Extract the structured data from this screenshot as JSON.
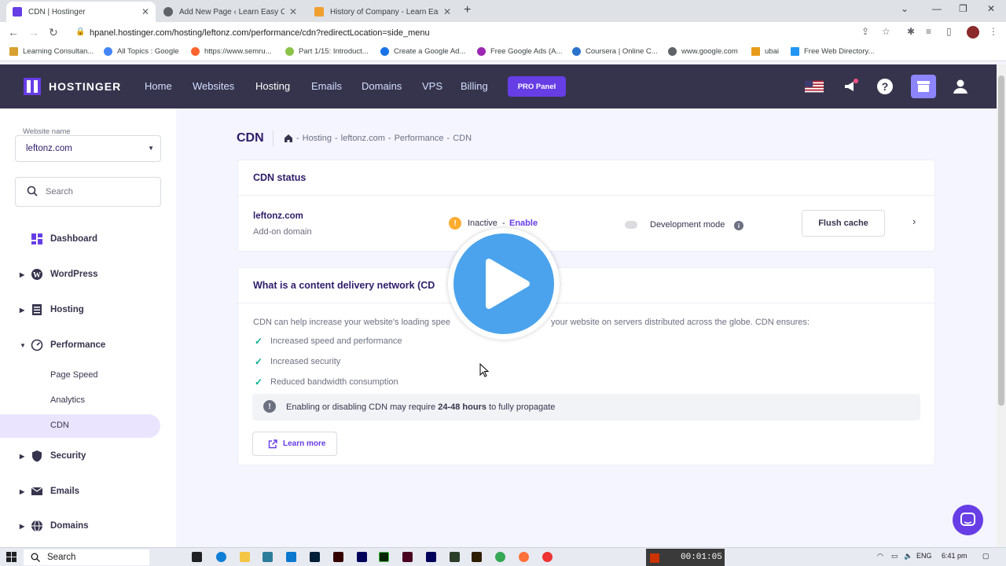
{
  "browser": {
    "tabs": [
      {
        "title": "CDN | Hostinger",
        "active": true
      },
      {
        "title": "Add New Page ‹ Learn Easy Codi",
        "active": false
      },
      {
        "title": "History of Company - Learn Easy",
        "active": false
      }
    ],
    "url": "hpanel.hostinger.com/hosting/leftonz.com/performance/cdn?redirectLocation=side_menu",
    "bookmarks": [
      "Learning Consultan...",
      "All Topics : Google",
      "https://www.semru...",
      "Part 1/15: Introduct...",
      "Create a Google Ad...",
      "Free Google Ads (A...",
      "Coursera | Online C...",
      "www.google.com",
      "ubai",
      "Free Web Directory..."
    ]
  },
  "header": {
    "brand": "HOSTINGER",
    "nav": [
      "Home",
      "Websites",
      "Hosting",
      "Emails",
      "Domains",
      "VPS",
      "Billing"
    ],
    "active_nav": "Hosting",
    "pro_panel": "PRO Panel"
  },
  "sidebar": {
    "website_label": "Website name",
    "website_value": "leftonz.com",
    "search_placeholder": "Search",
    "items": [
      {
        "label": "Dashboard",
        "icon": "dashboard-icon"
      },
      {
        "label": "WordPress",
        "icon": "wordpress-icon"
      },
      {
        "label": "Hosting",
        "icon": "server-icon"
      },
      {
        "label": "Performance",
        "icon": "gauge-icon"
      },
      {
        "label": "Security",
        "icon": "shield-icon"
      },
      {
        "label": "Emails",
        "icon": "mail-icon"
      },
      {
        "label": "Domains",
        "icon": "globe-icon"
      }
    ],
    "sub_items": [
      "Page Speed",
      "Analytics",
      "CDN"
    ]
  },
  "main": {
    "title": "CDN",
    "breadcrumb": [
      "Hosting",
      "leftonz.com",
      "Performance",
      "CDN"
    ],
    "status_card": {
      "title": "CDN status",
      "domain": "leftonz.com",
      "domain_type": "Add-on domain",
      "status": "Inactive",
      "enable": "Enable",
      "dev_mode": "Development mode",
      "flush": "Flush cache"
    },
    "info_card": {
      "title": "What is a content delivery network (CD",
      "description_left": "CDN can help increase your website's loading spee",
      "description_right": "your website on servers distributed across the globe. CDN ensures:",
      "features": [
        "Increased speed and performance",
        "Increased security",
        "Reduced bandwidth consumption"
      ],
      "note_before": "Enabling or disabling CDN may require ",
      "note_bold": "24-48 hours",
      "note_after": " to fully propagate",
      "learn_more": "Learn more"
    }
  },
  "taskbar": {
    "search": "Search",
    "lang": "ENG",
    "time": "6:41 pm",
    "recorder": "00:01:05"
  },
  "colors": {
    "header_bg": "#36344d",
    "accent": "#673de6",
    "play": "#4aa3ec",
    "check": "#00b090",
    "warning": "#ffac30"
  }
}
